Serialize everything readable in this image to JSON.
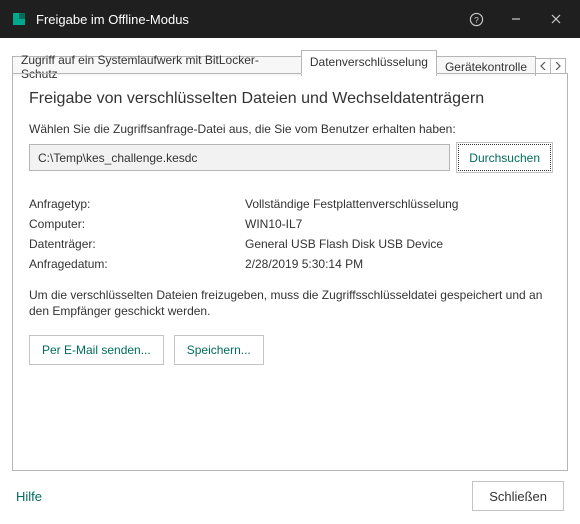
{
  "window": {
    "title": "Freigabe im Offline-Modus"
  },
  "tabs": {
    "bitlocker": "Zugriff auf ein Systemlaufwerk mit BitLocker-Schutz",
    "encryption": "Datenverschlüsselung",
    "device": "Gerätekontrolle"
  },
  "panel": {
    "heading": "Freigabe von verschlüsselten Dateien und Wechseldatenträgern",
    "instruction": "Wählen Sie die Zugriffsanfrage-Datei aus, die Sie vom Benutzer erhalten haben:",
    "file_path": "C:\\Temp\\kes_challenge.kesdc",
    "browse": "Durchsuchen",
    "labels": {
      "request_type": "Anfragetyp:",
      "computer": "Computer:",
      "drive": "Datenträger:",
      "request_date": "Anfragedatum:"
    },
    "values": {
      "request_type": "Vollständige Festplattenverschlüsselung",
      "computer": "WIN10-IL7",
      "drive": "General USB Flash Disk USB Device",
      "request_date": "2/28/2019 5:30:14 PM"
    },
    "note": "Um die verschlüsselten Dateien freizugeben, muss die Zugriffsschlüsseldatei gespeichert und an den Empfänger geschickt werden.",
    "send_email": "Per E-Mail senden...",
    "save": "Speichern..."
  },
  "footer": {
    "help": "Hilfe",
    "close": "Schließen"
  }
}
